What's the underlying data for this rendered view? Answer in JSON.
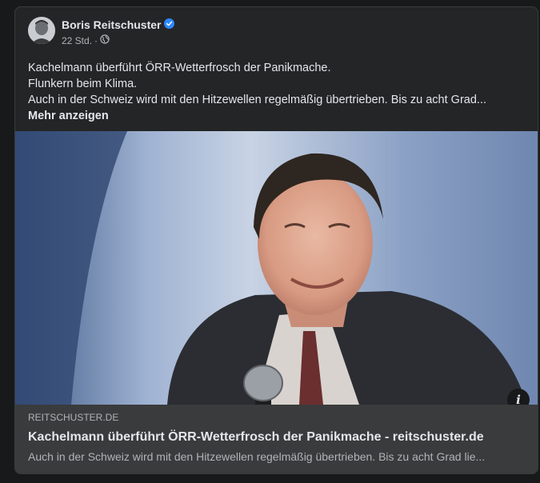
{
  "post": {
    "author": "Boris Reitschuster",
    "verified": true,
    "time": "22 Std.",
    "separator": "·",
    "audience_icon": "globe-icon",
    "lines": [
      "Kachelmann überführt ÖRR-Wetterfrosch der Panikmache.",
      "Flunkern beim Klima.",
      "Auch in der Schweiz wird mit den Hitzewellen regelmäßig übertrieben. Bis zu acht Grad..."
    ],
    "more_label": "Mehr anzeigen"
  },
  "link_preview": {
    "domain": "REITSCHUSTER.DE",
    "title": "Kachelmann überführt ÖRR-Wetterfrosch der Panikmache - reitschuster.de",
    "description": "Auch in der Schweiz wird mit den Hitzewellen regelmäßig übertrieben. Bis zu acht Grad lie...",
    "info_label": "i"
  },
  "colors": {
    "background": "#18191a",
    "card": "#242526",
    "link_box": "#3a3b3c",
    "verified_badge": "#2d88ff"
  }
}
